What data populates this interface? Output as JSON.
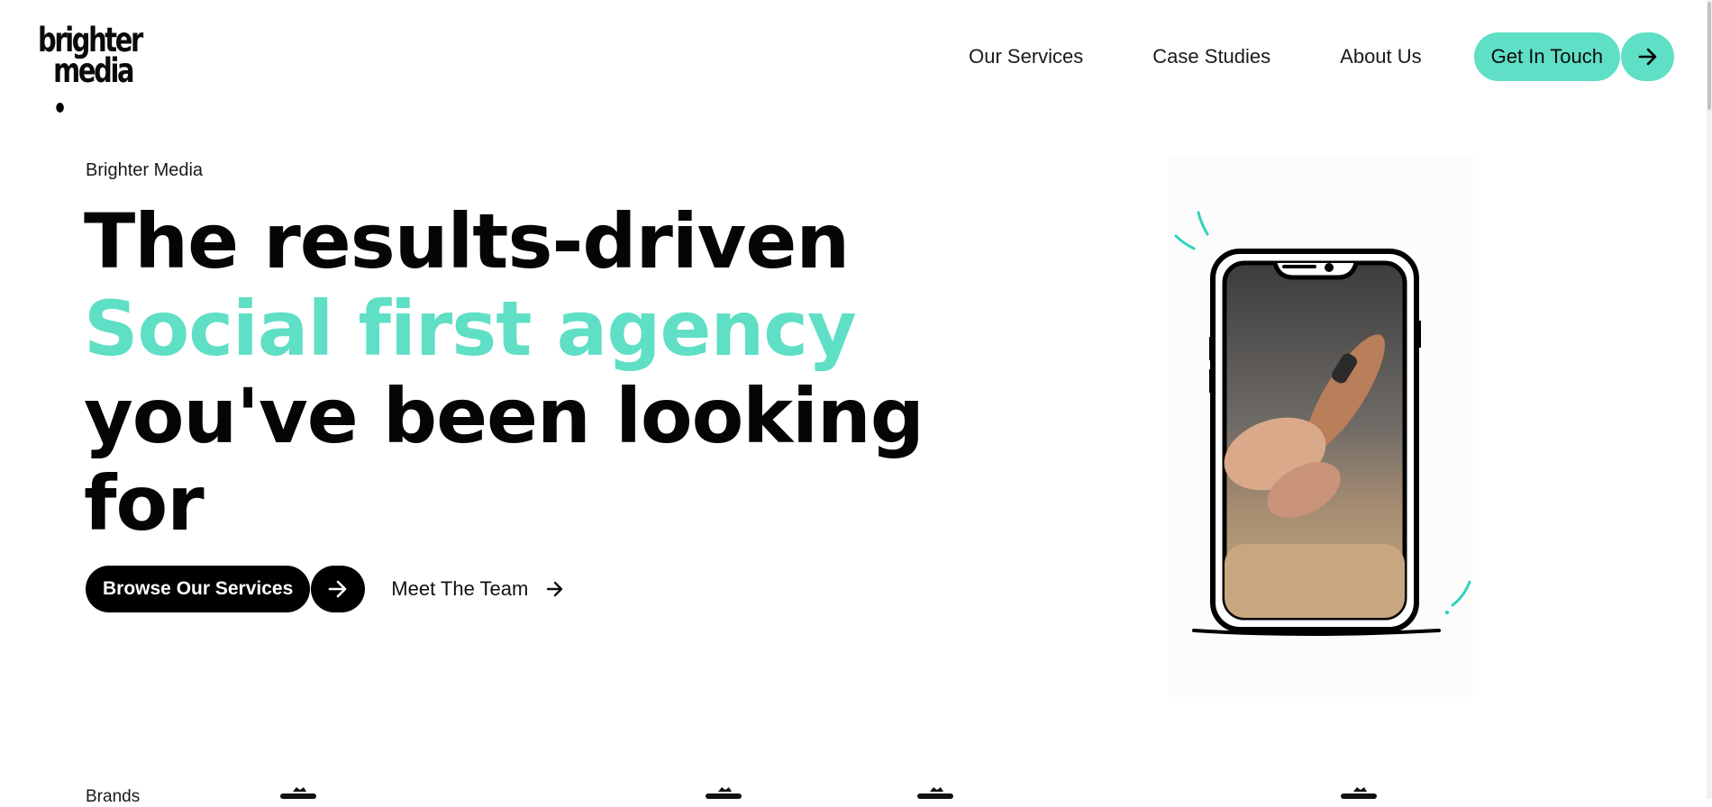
{
  "header": {
    "logo_line1": "brighter",
    "logo_line2": "media",
    "nav": [
      "Our Services",
      "Case Studies",
      "About Us"
    ],
    "cta_label": "Get In Touch"
  },
  "hero": {
    "eyebrow": "Brighter Media",
    "line1": "The results-driven",
    "line2": "Social first agency",
    "line3": "you've been looking",
    "line4": "for",
    "primary_button": "Browse Our Services",
    "secondary_link": "Meet The Team"
  },
  "brands": {
    "label": "Brands"
  },
  "icons": {
    "cta": "arrow-right-icon",
    "primary": "arrow-right-icon",
    "secondary": "arrow-right-icon",
    "illustration": "phone-illustration"
  },
  "colors": {
    "accent": "#5fdfc5",
    "dark": "#000000",
    "background": "#ffffff"
  }
}
